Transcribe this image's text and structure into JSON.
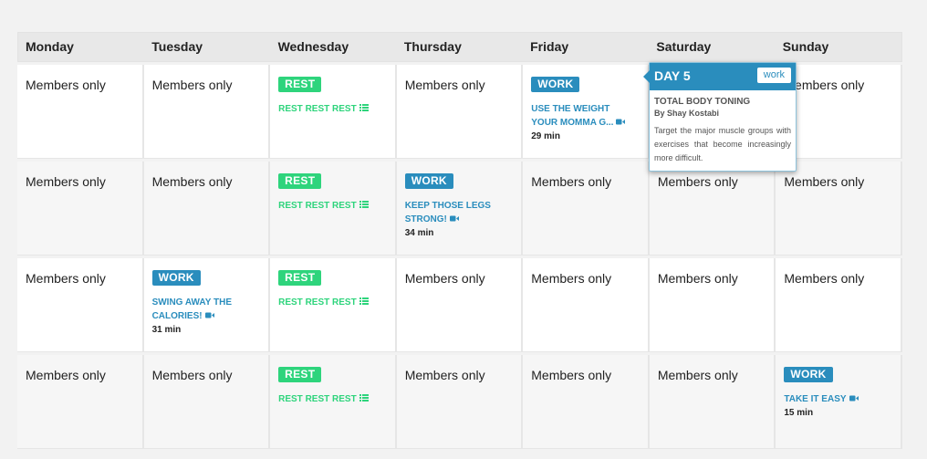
{
  "days": [
    "Monday",
    "Tuesday",
    "Wednesday",
    "Thursday",
    "Friday",
    "Saturday",
    "Sunday"
  ],
  "members_label": "Members only",
  "colors": {
    "rest": "#2ed47c",
    "work": "#2a8dbd"
  },
  "weeks": [
    [
      {
        "type": "members"
      },
      {
        "type": "members"
      },
      {
        "type": "rest",
        "badge": "REST",
        "title": "REST REST REST",
        "icon": "list-icon"
      },
      {
        "type": "members"
      },
      {
        "type": "work",
        "badge": "WORK",
        "title": "USE THE WEIGHT YOUR MOMMA G...",
        "icon": "video-icon",
        "duration": "29 min"
      },
      {
        "type": "members"
      },
      {
        "type": "members"
      }
    ],
    [
      {
        "type": "members"
      },
      {
        "type": "members"
      },
      {
        "type": "rest",
        "badge": "REST",
        "title": "REST REST REST",
        "icon": "list-icon"
      },
      {
        "type": "work",
        "badge": "WORK",
        "title": "KEEP THOSE LEGS STRONG!",
        "icon": "video-icon",
        "duration": "34 min"
      },
      {
        "type": "members"
      },
      {
        "type": "members"
      },
      {
        "type": "members"
      }
    ],
    [
      {
        "type": "members"
      },
      {
        "type": "work",
        "badge": "WORK",
        "title": "SWING AWAY THE CALORIES!",
        "icon": "video-icon",
        "duration": "31 min"
      },
      {
        "type": "rest",
        "badge": "REST",
        "title": "REST REST REST",
        "icon": "list-icon"
      },
      {
        "type": "members"
      },
      {
        "type": "members"
      },
      {
        "type": "members"
      },
      {
        "type": "members"
      }
    ],
    [
      {
        "type": "members"
      },
      {
        "type": "members"
      },
      {
        "type": "rest",
        "badge": "REST",
        "title": "REST REST REST",
        "icon": "list-icon"
      },
      {
        "type": "members"
      },
      {
        "type": "members"
      },
      {
        "type": "members"
      },
      {
        "type": "work",
        "badge": "WORK",
        "title": "TAKE IT EASY",
        "icon": "video-icon",
        "duration": "15 min"
      }
    ]
  ],
  "popup": {
    "day_label": "DAY 5",
    "type_label": "work",
    "title": "TOTAL BODY TONING",
    "author": "By Shay Kostabi",
    "description": "Target the major muscle groups with exercises that become increasingly more difficult."
  }
}
